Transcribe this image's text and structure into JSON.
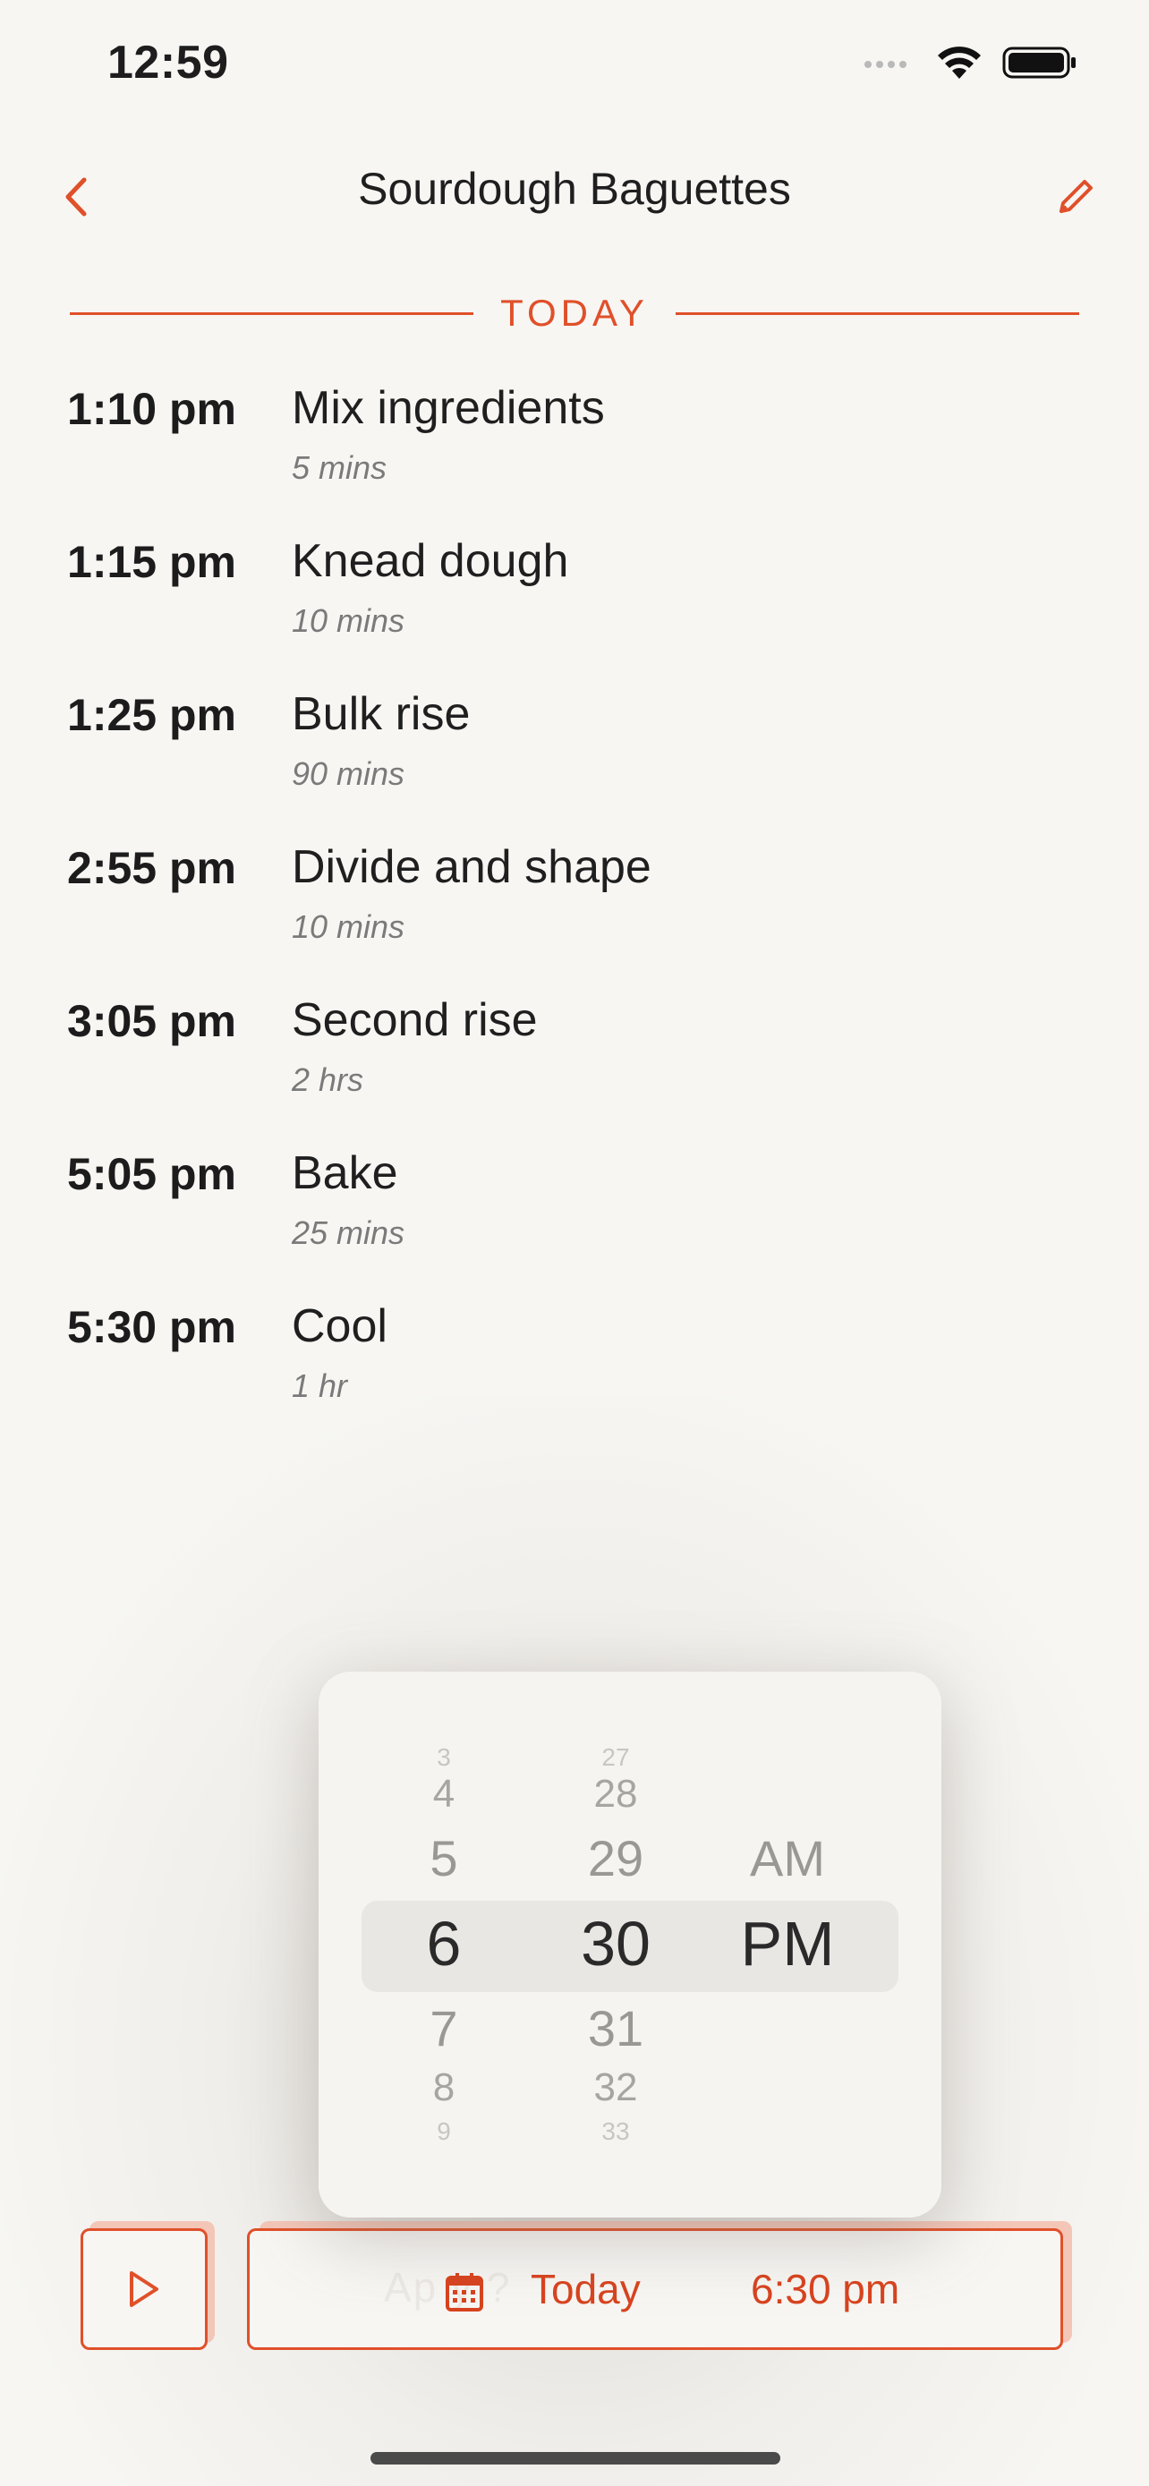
{
  "status_bar": {
    "time": "12:59",
    "signal_icon": "cellular-signal-icon",
    "wifi_icon": "wifi-icon",
    "battery_icon": "battery-icon"
  },
  "nav": {
    "title": "Sourdough Baguettes",
    "back_icon": "chevron-left-icon",
    "edit_icon": "pencil-icon"
  },
  "day_label": "TODAY",
  "steps": [
    {
      "time": "1:10 pm",
      "name": "Mix ingredients",
      "duration": "5 mins"
    },
    {
      "time": "1:15 pm",
      "name": "Knead dough",
      "duration": "10 mins"
    },
    {
      "time": "1:25 pm",
      "name": "Bulk rise",
      "duration": "90 mins"
    },
    {
      "time": "2:55 pm",
      "name": "Divide and shape",
      "duration": "10 mins"
    },
    {
      "time": "3:05 pm",
      "name": "Second rise",
      "duration": "2 hrs"
    },
    {
      "time": "5:05 pm",
      "name": "Bake",
      "duration": "25 mins"
    },
    {
      "time": "5:30 pm",
      "name": "Cool",
      "duration": "1 hr"
    }
  ],
  "picker": {
    "hours": [
      "3",
      "4",
      "5",
      "6",
      "7",
      "8",
      "9"
    ],
    "minutes": [
      "27",
      "28",
      "29",
      "30",
      "31",
      "32",
      "33"
    ],
    "ampm": [
      "AM",
      "PM"
    ],
    "selected": {
      "hour": "6",
      "minute": "30",
      "ampm": "PM"
    }
  },
  "actions": {
    "play_icon": "play-icon",
    "calendar_icon": "calendar-icon",
    "ghost_label": "Ap      y      ?",
    "day": "Today",
    "time": "6:30 pm"
  },
  "colors": {
    "accent": "#e0502a",
    "background": "#f7f6f3"
  }
}
